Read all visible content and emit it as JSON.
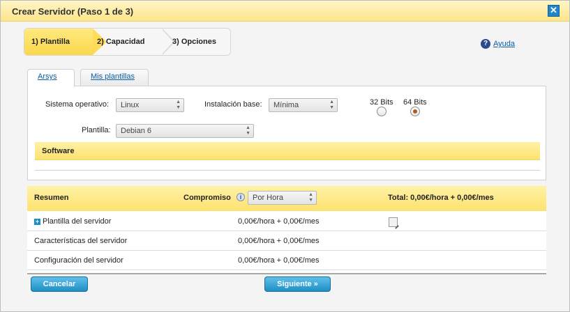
{
  "window": {
    "title": "Crear Servidor (Paso 1 de 3)",
    "close_label": "✕"
  },
  "steps": [
    {
      "label": "1) Plantilla"
    },
    {
      "label": "2) Capacidad"
    },
    {
      "label": "3) Opciones"
    }
  ],
  "help": {
    "label": "Ayuda",
    "icon": "?"
  },
  "tabs": [
    {
      "label": "Arsys"
    },
    {
      "label": "Mis plantillas"
    }
  ],
  "form": {
    "os_label": "Sistema operativo:",
    "os_value": "Linux",
    "base_label": "Instalación base:",
    "base_value": "Mínima",
    "bits32_label": "32 Bits",
    "bits64_label": "64 Bits",
    "template_label": "Plantilla:",
    "template_value": "Debian 6",
    "software_label": "Software"
  },
  "summary": {
    "title": "Resumen",
    "commitment_label": "Compromiso",
    "info_icon": "i",
    "commitment_value": "Por Hora",
    "total_label": "Total: 0,00€/hora + 0,00€/mes",
    "rows": [
      {
        "name": "Plantilla del servidor",
        "price": "0,00€/hora + 0,00€/mes"
      },
      {
        "name": "Características del servidor",
        "price": "0,00€/hora + 0,00€/mes"
      },
      {
        "name": "Configuración del servidor",
        "price": "0,00€/hora + 0,00€/mes"
      }
    ]
  },
  "buttons": {
    "cancel": "Cancelar",
    "next": "Siguiente »"
  },
  "colors": {
    "accent_yellow": "#fde26f",
    "button_blue": "#1e8fc6",
    "link_blue": "#0a5ea8"
  }
}
